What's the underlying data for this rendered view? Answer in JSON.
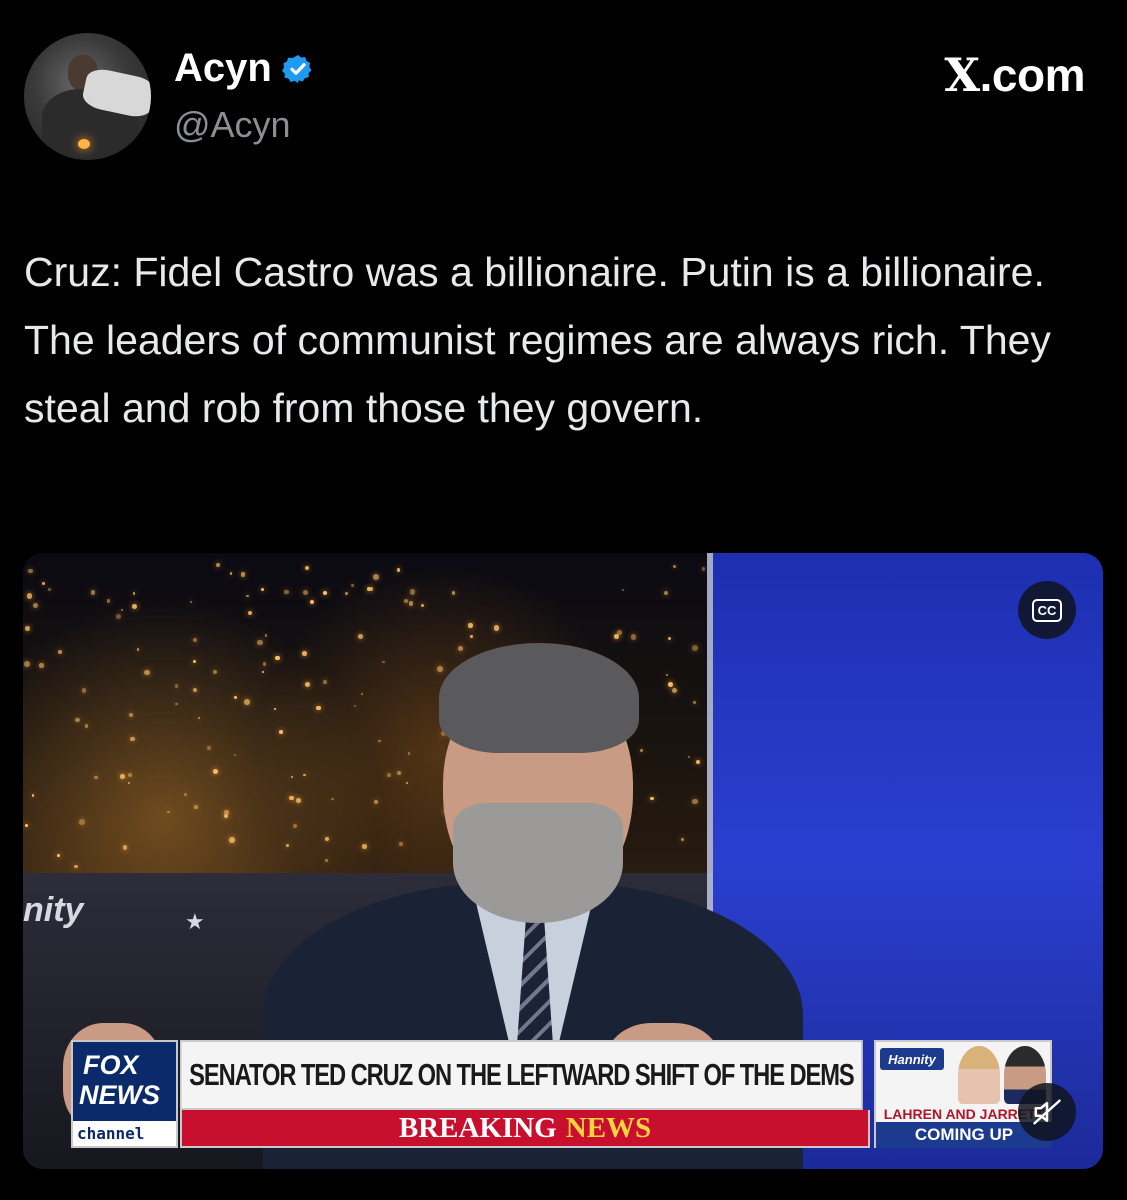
{
  "author": {
    "display_name": "Acyn",
    "handle": "@Acyn",
    "verified": true
  },
  "brand": {
    "label": "X.com"
  },
  "tweet": {
    "text": "Cruz: Fidel Castro was a billionaire. Putin is a billionaire. The leaders of communist regimes are always rich. They steal and rob from those they govern."
  },
  "video": {
    "controls": {
      "cc_label": "CC"
    },
    "show_logo": "nity",
    "chyron": {
      "network_line1": "FOX",
      "network_line2": "NEWS",
      "network_line3": "channel",
      "headline": "SENATOR TED CRUZ ON THE LEFTWARD SHIFT OF THE DEMS",
      "breaking_word1": "BREAKING",
      "breaking_word2": "NEWS",
      "promo_show": "Hannity",
      "promo_names": "LAHREN AND JARRETT",
      "promo_status": "COMING UP"
    }
  },
  "colors": {
    "verified_badge": "#1d9bf0",
    "breaking_red": "#c8102e",
    "fox_blue": "#0b2a6b"
  }
}
